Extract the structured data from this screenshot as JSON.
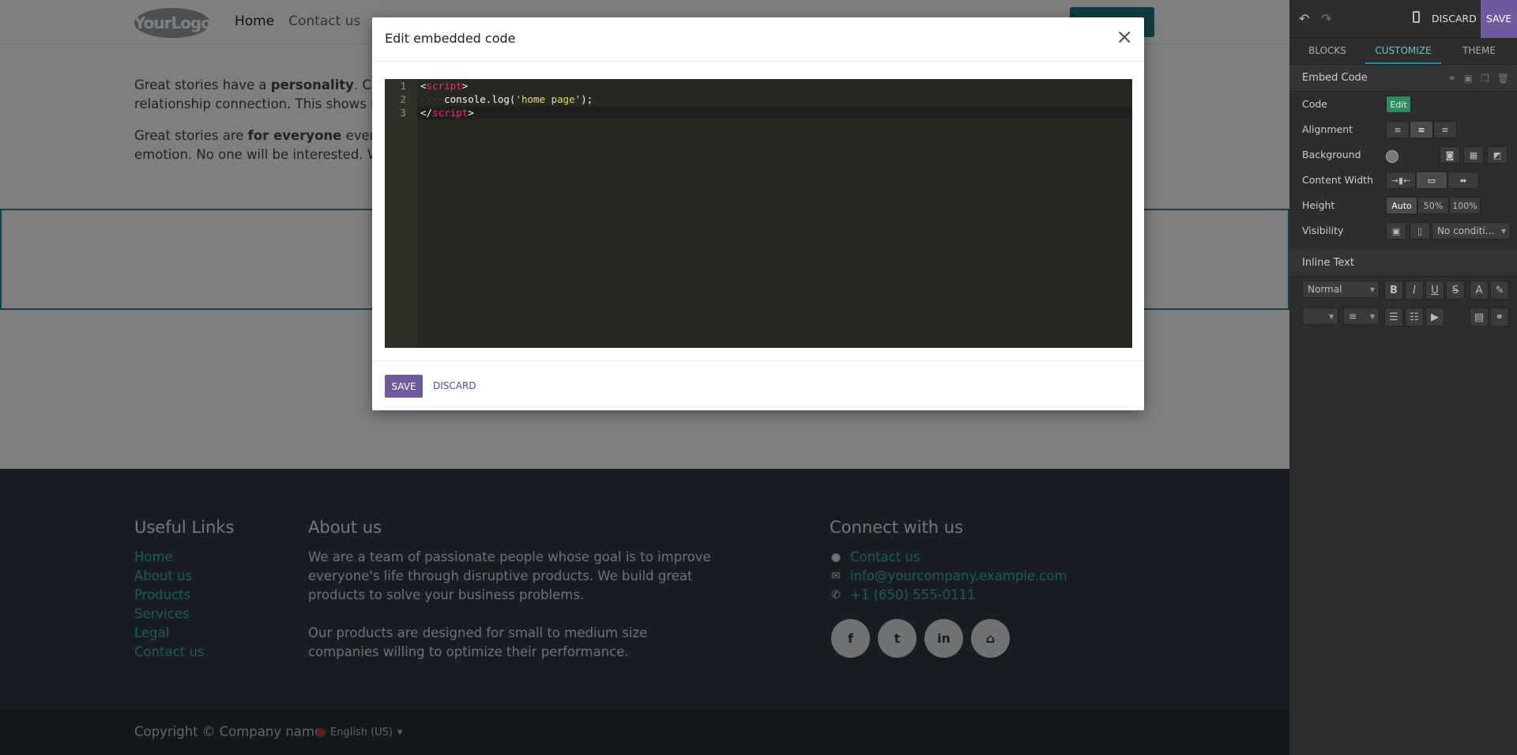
{
  "site": {
    "logo": "YourLogo",
    "nav": {
      "home": "Home",
      "contact": "Contact us"
    },
    "content": {
      "p1_a": "Great stories have a ",
      "p1_b": "personality",
      "p1_c": ". Consid",
      "p1_d": "relationship connection. This shows up i",
      "p2_a": "Great stories are ",
      "p2_b": "for everyone",
      "p2_c": " even whe",
      "p2_d": "emotion. No one will be interested. Write"
    },
    "footer": {
      "useful_title": "Useful Links",
      "links": [
        "Home",
        "About us",
        "Products",
        "Services",
        "Legal",
        "Contact us"
      ],
      "about_title": "About us",
      "about_p1": "We are a team of passionate people whose goal is to improve everyone's life through disruptive products. We build great products to solve your business problems.",
      "about_p2": "Our products are designed for small to medium size companies willing to optimize their performance.",
      "connect_title": "Connect with us",
      "contact_label": "Contact us",
      "email": "info@yourcompany.example.com",
      "phone": "+1 (650) 555-0111",
      "socials": [
        "f",
        "t",
        "in",
        "⌂"
      ]
    },
    "copyright": "Copyright © Company name",
    "language": "English (US)"
  },
  "modal": {
    "title": "Edit embedded code",
    "close": "×",
    "line_numbers": [
      "1",
      "2",
      "3"
    ],
    "code": {
      "l1_open": "<",
      "l1_tag": "script",
      "l1_close": ">",
      "l2_indent": "····",
      "l2_code": "console.log(",
      "l2_str": "'home page'",
      "l2_end": ");",
      "l3_open": "</",
      "l3_tag": "script",
      "l3_close": ">"
    },
    "save_label": "SAVE",
    "discard_label": "DISCARD"
  },
  "panel": {
    "discard": "DISCARD",
    "save": "SAVE",
    "tabs": [
      "BLOCKS",
      "CUSTOMIZE",
      "THEME"
    ],
    "active_tab": "CUSTOMIZE",
    "section1": "Embed Code",
    "options": {
      "code": "Code",
      "edit": "Edit",
      "alignment": "Alignment",
      "background": "Background",
      "content_width": "Content Width",
      "height": "Height",
      "height_opts": [
        "Auto",
        "50%",
        "100%"
      ],
      "visibility": "Visibility",
      "visibility_value": "No conditi..."
    },
    "section2": "Inline Text",
    "text_style": "Normal"
  },
  "colors": {
    "accent": "#1f8a94",
    "primary": "#6f5a9e",
    "editor_bg": "#272822"
  }
}
